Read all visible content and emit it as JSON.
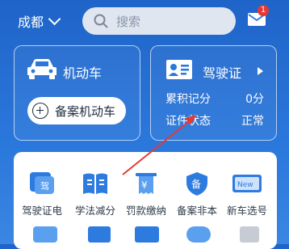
{
  "header": {
    "city": "成都",
    "search_placeholder": "搜索",
    "mail_badge": "1"
  },
  "vehicle_card": {
    "title": "机动车",
    "register_button": "备案机动车"
  },
  "license_card": {
    "title": "驾驶证",
    "points_label": "累积记分",
    "points_value": "0分",
    "status_label": "证件状态",
    "status_value": "正常"
  },
  "services": [
    {
      "label": "驾驶证电",
      "icon": "license-card-icon"
    },
    {
      "label": "学法减分",
      "icon": "book-icon"
    },
    {
      "label": "罚款缴纳",
      "icon": "receipt-icon"
    },
    {
      "label": "备案非本",
      "icon": "shield-icon"
    },
    {
      "label": "新车选号",
      "icon": "new-plate-icon"
    }
  ],
  "colors": {
    "brand_blue": "#2b78dc",
    "accent_blue": "#2e7be0",
    "badge_red": "#e53935",
    "annotation_arrow": "#e53935"
  }
}
